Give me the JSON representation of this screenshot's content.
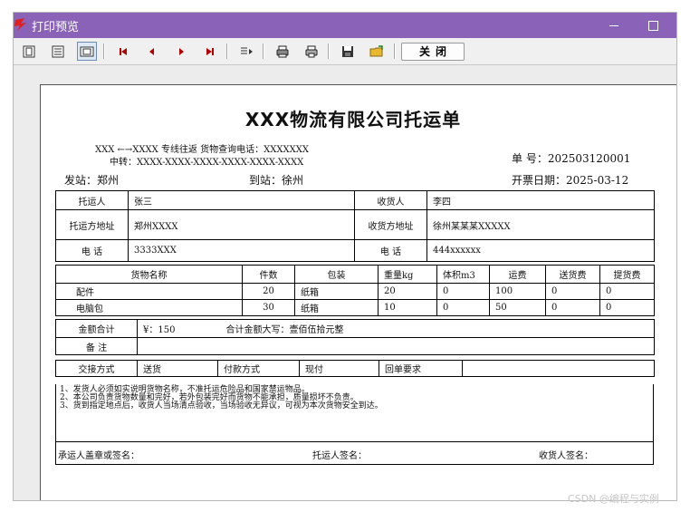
{
  "window": {
    "title": "打印预览",
    "close_label": "关闭"
  },
  "toolbar": {
    "icons": [
      "single-page-icon",
      "multi-page-icon",
      "page-setup-icon",
      "first-page-icon",
      "prev-page-icon",
      "next-page-icon",
      "last-page-icon",
      "goto-page-icon",
      "print-setup-icon",
      "print-icon",
      "save-icon",
      "open-icon"
    ]
  },
  "doc": {
    "title": "XXX物流有限公司托运单",
    "route_line": "XXX ←→XXXX 专线往返 货物查询电话：XXXXXXX",
    "transfer_line": "中转：XXXX-XXXX-XXXX-XXXX-XXXX-XXXX",
    "order_no_label": "单  号：",
    "order_no": "202503120001",
    "from_label": "发站：",
    "from": "郑州",
    "to_label": "到站：",
    "to": "徐州",
    "date_label": "开票日期：",
    "date": "2025-03-12"
  },
  "parties": {
    "shipper_label": "托运人",
    "shipper": "张三",
    "consignee_label": "收货人",
    "consignee": "李四",
    "shipper_addr_label": "托运方地址",
    "shipper_addr": "郑州XXXX",
    "consignee_addr_label": "收货方地址",
    "consignee_addr": "徐州某某某XXXXX",
    "phone_label": "电  话",
    "shipper_phone": "3333XXX",
    "consignee_phone_label": "电  话",
    "consignee_phone": "444xxxxxx"
  },
  "goods": {
    "headers": [
      "货物名称",
      "件数",
      "包装",
      "重量kg",
      "体积m3",
      "运费",
      "送货费",
      "提货费"
    ],
    "rows": [
      [
        "配件",
        "20",
        "纸箱",
        "20",
        "0",
        "100",
        "0",
        "0"
      ],
      [
        "电脑包",
        "30",
        "纸箱",
        "10",
        "0",
        "50",
        "0",
        "0"
      ]
    ]
  },
  "totals": {
    "amount_label": "金额合计",
    "amount": "¥：150",
    "amount_upper_label": "合计金额大写：",
    "amount_upper": "壹佰伍拾元整",
    "remarks_label": "备  注",
    "handover_label": "交接方式",
    "handover": "送货",
    "payment_label": "付款方式",
    "payment": "现付",
    "receipt_label": "回单要求",
    "receipt": ""
  },
  "notes": [
    "1、发货人必须如实说明货物名称，不准托运危险品和国家禁运物品。",
    "2、本公司负责货物数量和完好，若外包装完好而货物不能承担，质量损坏不负责。",
    "3、货到指定地点后，收货人当场清点验收，当场验收无异议，可视为本次货物安全到达。"
  ],
  "signatures": {
    "carrier": "承运人盖章或签名：",
    "shipper": "托运人签名：",
    "consignee": "收货人签名："
  },
  "watermark": "CSDN @编程与实例"
}
